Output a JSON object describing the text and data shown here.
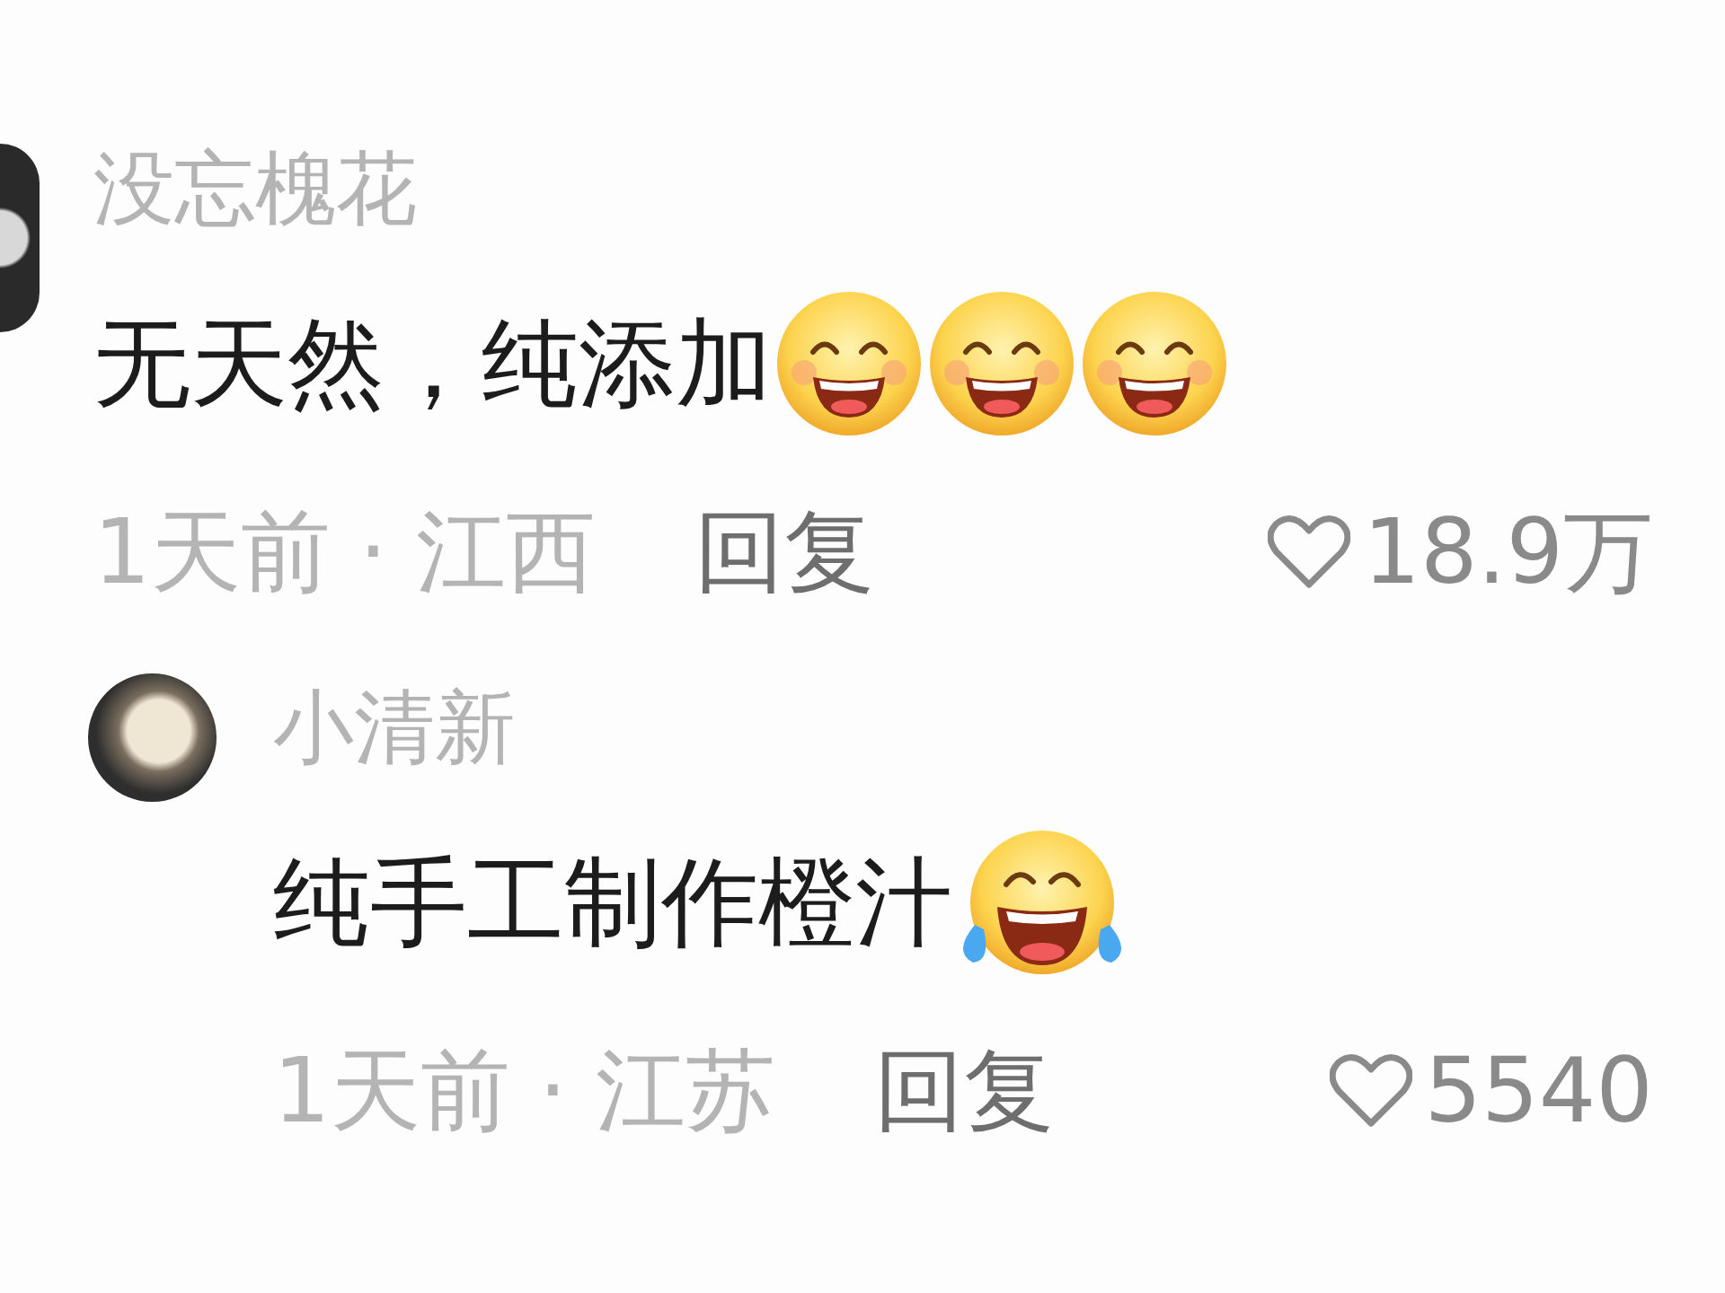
{
  "comments": [
    {
      "kind": "comment",
      "username": "没忘槐花",
      "text": "无天然，纯添加",
      "emojis": [
        {
          "kind": "grin"
        },
        {
          "kind": "grin"
        },
        {
          "kind": "grin"
        }
      ],
      "meta": "1天前 · 江西",
      "reply": "回复",
      "likes": "18.9万"
    },
    {
      "kind": "reply",
      "username": "小清新",
      "text": "纯手工制作橙汁",
      "emojis": [
        {
          "kind": "tears"
        }
      ],
      "meta": "1天前 · 江苏",
      "reply": "回复",
      "likes": "5540"
    }
  ]
}
